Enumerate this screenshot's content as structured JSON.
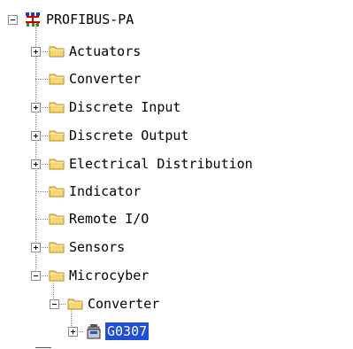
{
  "tree": {
    "root": {
      "label": "PROFIBUS-PA",
      "icon": "network-icon",
      "expanded": true
    },
    "items": [
      {
        "label": "Actuators",
        "expander": "plus",
        "icon": "folder-icon"
      },
      {
        "label": "Converter",
        "expander": "none",
        "icon": "folder-icon"
      },
      {
        "label": "Discrete Input",
        "expander": "plus",
        "icon": "folder-icon"
      },
      {
        "label": "Discrete Output",
        "expander": "plus",
        "icon": "folder-icon"
      },
      {
        "label": "Electrical Distribution",
        "expander": "plus",
        "icon": "folder-icon"
      },
      {
        "label": "Indicator",
        "expander": "none",
        "icon": "folder-icon"
      },
      {
        "label": "Remote I/O",
        "expander": "none",
        "icon": "folder-icon"
      },
      {
        "label": "Sensors",
        "expander": "plus",
        "icon": "folder-icon"
      },
      {
        "label": "Microcyber",
        "expander": "minus",
        "icon": "folder-icon"
      }
    ],
    "microcyber_children": [
      {
        "label": "Converter",
        "expander": "minus",
        "icon": "folder-icon"
      }
    ],
    "converter_children": [
      {
        "label": "G0307",
        "expander": "plus",
        "icon": "device-icon",
        "selected": true
      }
    ]
  },
  "colors": {
    "folder_fill": "#f7d774",
    "folder_edge": "#b08a2a",
    "selection": "#1f4fd6"
  }
}
